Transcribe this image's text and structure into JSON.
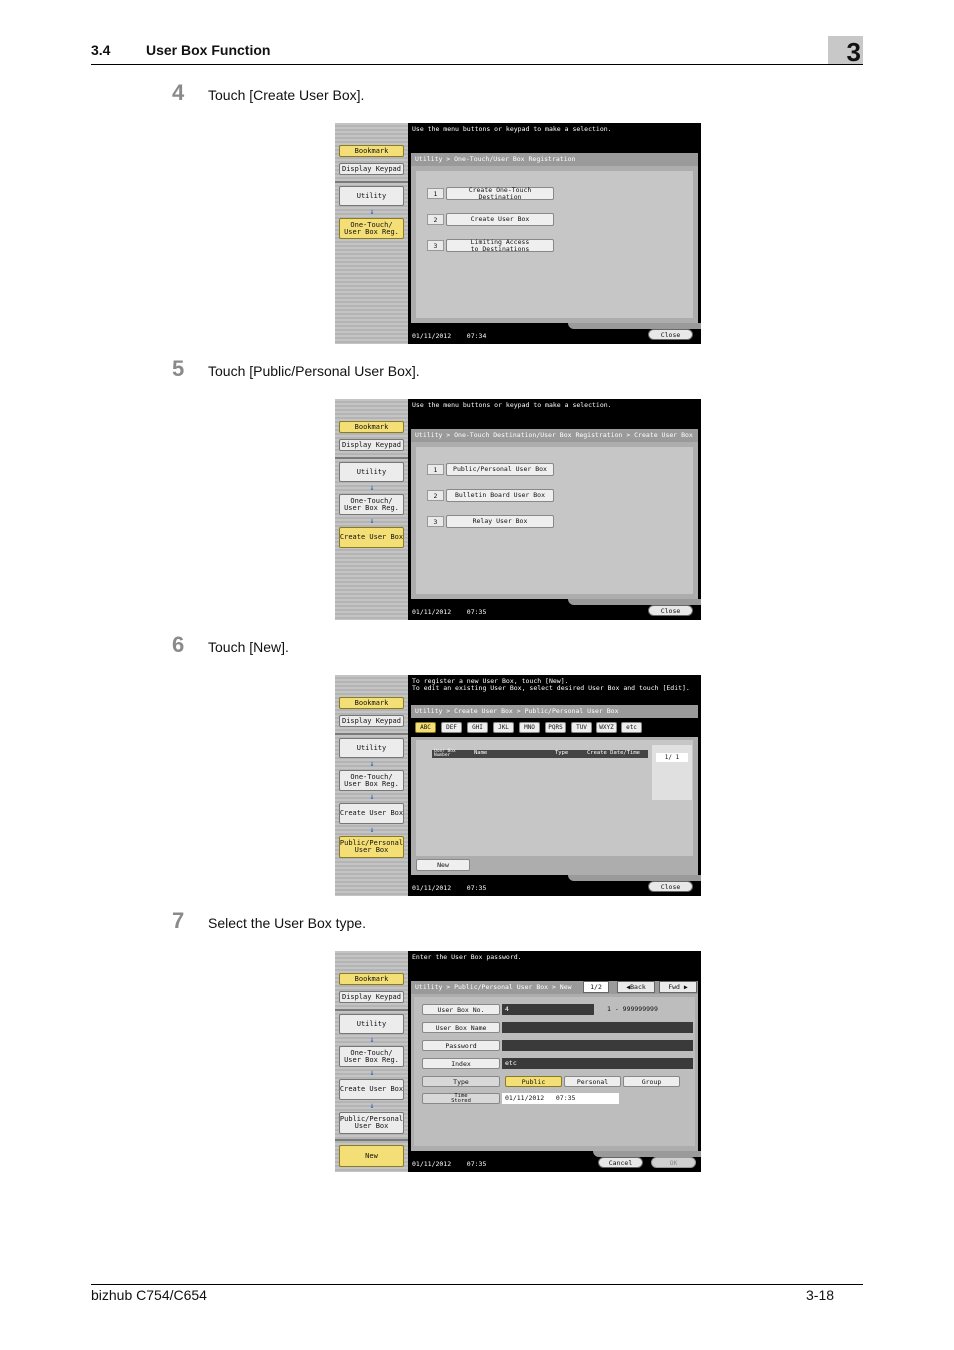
{
  "header": {
    "section": "3.4",
    "title": "User Box Function",
    "chapter": "3"
  },
  "steps": [
    {
      "num": "4",
      "text": "Touch [Create User Box]."
    },
    {
      "num": "5",
      "text": "Touch [Public/Personal User Box]."
    },
    {
      "num": "6",
      "text": "Touch [New]."
    },
    {
      "num": "7",
      "text": "Select the User Box type."
    }
  ],
  "common": {
    "bookmark": "Bookmark",
    "display_keypad": "Display Keypad",
    "utility": "Utility",
    "one_touch": "One-Touch/\nUser Box Reg.",
    "create_user_box": "Create User Box",
    "public_personal": "Public/Personal\nUser Box",
    "new": "New",
    "close": "Close",
    "date": "01/11/2012",
    "time1": "07:34",
    "time2": "07:35",
    "menu_msg": "Use the menu buttons or keypad to make a selection."
  },
  "screen1": {
    "breadcrumb": "Utility > One-Touch/User Box Registration",
    "items": [
      {
        "num": "1",
        "label": "Create One-Touch\nDestination"
      },
      {
        "num": "2",
        "label": "Create User Box"
      },
      {
        "num": "3",
        "label": "Limiting Access\nto Destinations"
      }
    ]
  },
  "screen2": {
    "breadcrumb": "Utility > One-Touch Destination/User Box Registration > Create User Box",
    "items": [
      {
        "num": "1",
        "label": "Public/Personal User Box"
      },
      {
        "num": "2",
        "label": "Bulletin Board User Box"
      },
      {
        "num": "3",
        "label": "Relay User Box"
      }
    ]
  },
  "screen3": {
    "message": "To register a new User Box, touch [New].\nTo edit an existing User Box, select desired User Box and touch [Edit].",
    "breadcrumb": "Utility > Create User Box > Public/Personal User Box",
    "tabs": [
      "ABC",
      "DEF",
      "GHI",
      "JKL",
      "MNO",
      "PQRS",
      "TUV",
      "WXYZ",
      "etc"
    ],
    "columns": [
      "User Box\nNumber",
      "Name",
      "Type",
      "Create Date/Time"
    ],
    "page": "1/  1",
    "new_button": "New"
  },
  "screen4": {
    "message": "Enter the User Box password.",
    "breadcrumb": "Utility > Public/Personal User Box > New",
    "page": "1/2",
    "back": "Back",
    "fwd": "Fwd",
    "fields": {
      "user_box_no_label": "User Box No.",
      "user_box_no_value": "4",
      "user_box_no_range": "1 - 999999999",
      "user_box_name_label": "User Box Name",
      "password_label": "Password",
      "index_label": "Index",
      "index_value": "etc",
      "type_label": "Type",
      "type_public": "Public",
      "type_personal": "Personal",
      "type_group": "Group",
      "time_stored_label": "Time\nStored",
      "time_stored_value": "01/11/2012   07:35"
    },
    "cancel": "Cancel",
    "ok": "OK"
  },
  "footer": {
    "model": "bizhub C754/C654",
    "page": "3-18"
  }
}
